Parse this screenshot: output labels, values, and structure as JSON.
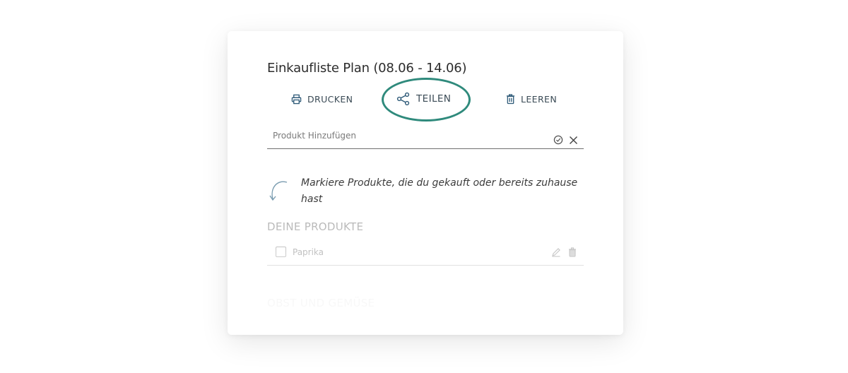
{
  "title": "Einkaufliste Plan (08.06 - 14.06)",
  "actions": {
    "print": {
      "label": "DRUCKEN",
      "icon": "printer-icon"
    },
    "share": {
      "label": "TEILEN",
      "icon": "share-icon"
    },
    "clear": {
      "label": "LEEREN",
      "icon": "trash-icon"
    }
  },
  "add_field": {
    "placeholder": "Produkt Hinzufügen",
    "value": ""
  },
  "hint": {
    "text": "Markiere Produkte, die du gekauft oder bereits zuhause hast",
    "icon": "curved-arrow-icon"
  },
  "sections": [
    {
      "title": "DEINE PRODUKTE",
      "items": [
        {
          "label": "Paprika",
          "checked": false
        }
      ]
    },
    {
      "title": "OBST UND GEMÜSE"
    }
  ],
  "colors": {
    "highlight": "#2f8a7c",
    "text": "#2c2c2c",
    "muted": "#a6a6a6"
  }
}
